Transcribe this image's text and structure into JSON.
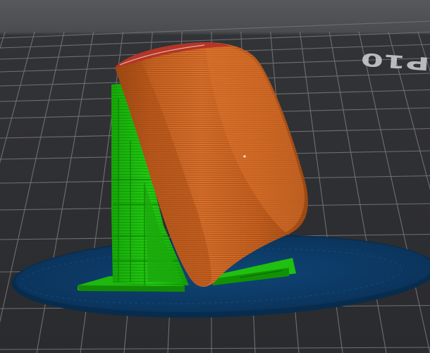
{
  "viewport": {
    "bed_label": "P10",
    "colors": {
      "background_top": "#55565a",
      "background_bottom": "#2a2b2e",
      "bed_grid": "#707276",
      "bed_label": "#c8cacc",
      "brim": "#0c3b66",
      "brim_edge": "#082a4a",
      "support": "#1fc30f",
      "support_dark": "#139c08",
      "model": "#c4601e",
      "model_light": "#e07a35",
      "model_dark": "#9a4512",
      "model_top": "#b53526"
    },
    "icons": {
      "support_structure": "support-structure",
      "printed_model": "sliced-model",
      "brim": "brim-skirt"
    }
  }
}
